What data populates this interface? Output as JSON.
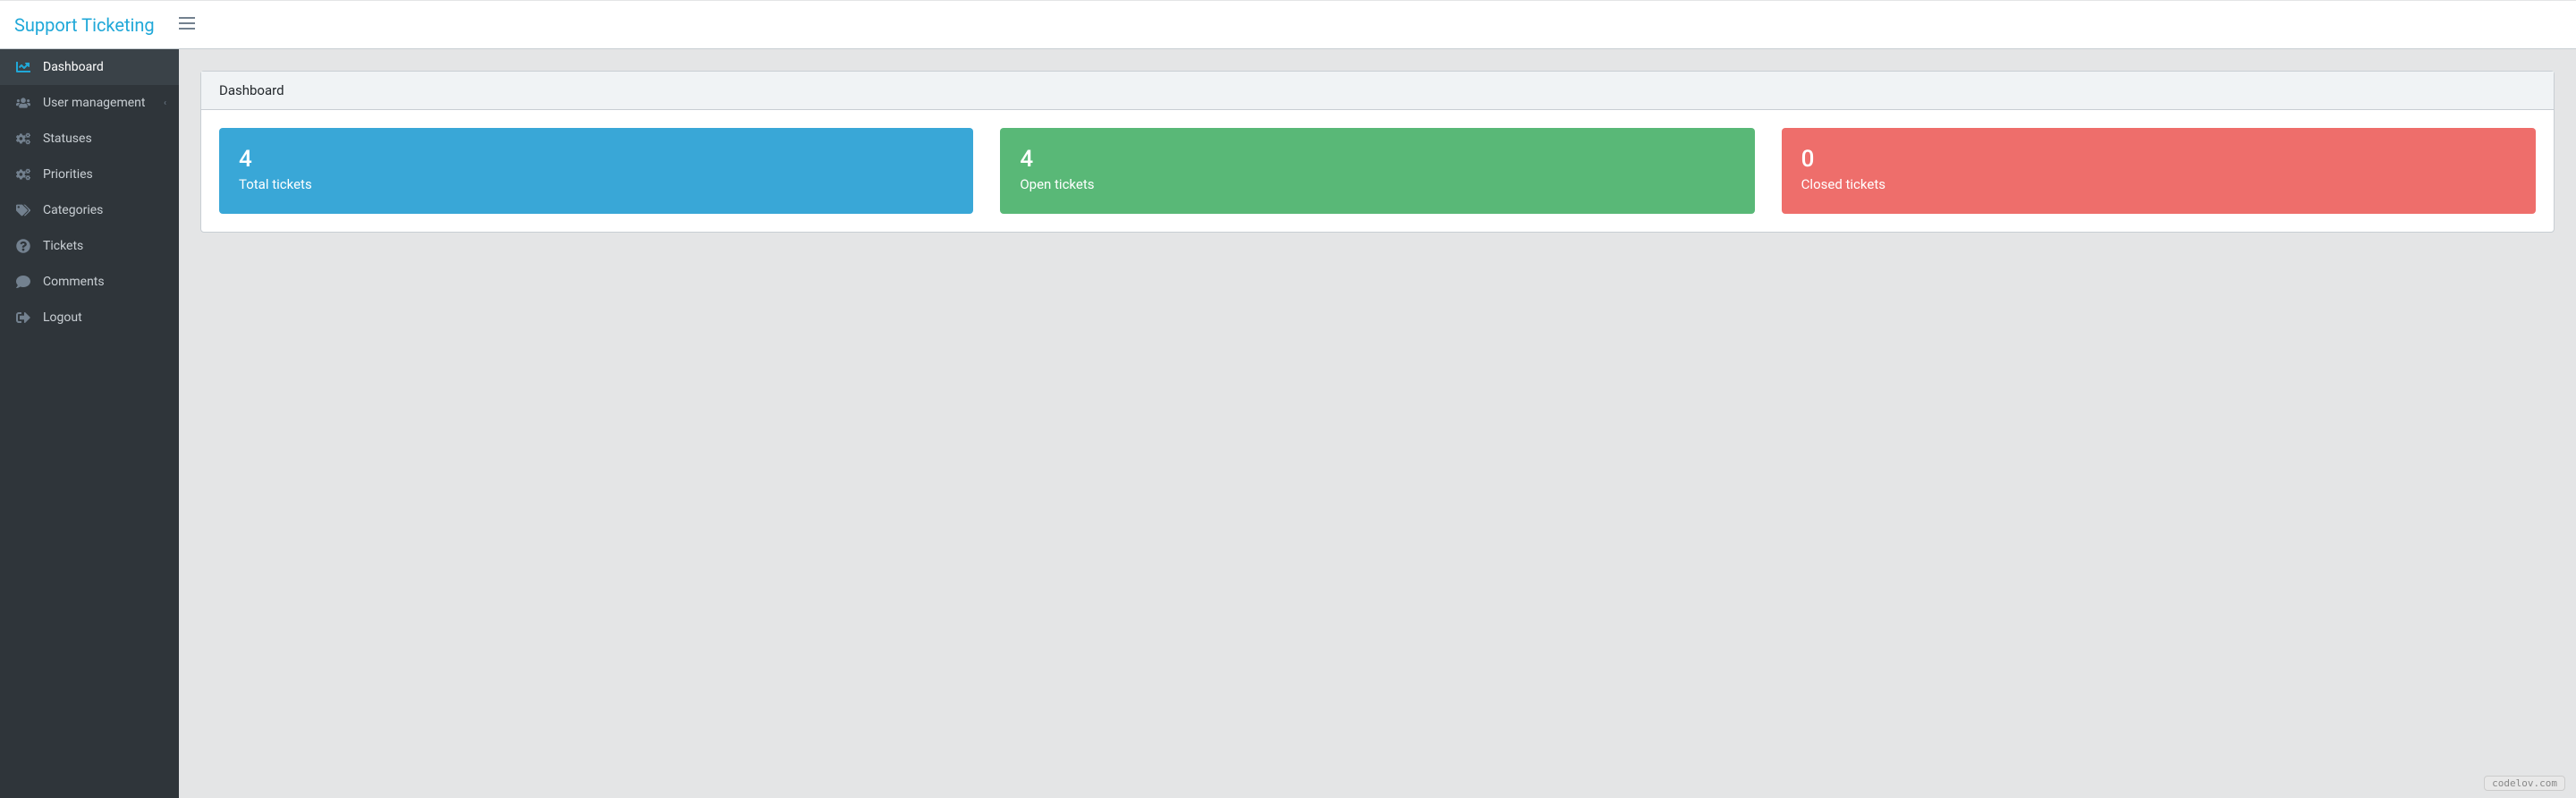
{
  "header": {
    "brand": "Support Ticketing"
  },
  "sidebar": {
    "items": [
      {
        "label": "Dashboard",
        "icon": "dashboard-icon",
        "active": true,
        "expandable": false
      },
      {
        "label": "User management",
        "icon": "users-icon",
        "active": false,
        "expandable": true
      },
      {
        "label": "Statuses",
        "icon": "cogs-icon",
        "active": false,
        "expandable": false
      },
      {
        "label": "Priorities",
        "icon": "cogs-icon",
        "active": false,
        "expandable": false
      },
      {
        "label": "Categories",
        "icon": "tags-icon",
        "active": false,
        "expandable": false
      },
      {
        "label": "Tickets",
        "icon": "question-icon",
        "active": false,
        "expandable": false
      },
      {
        "label": "Comments",
        "icon": "comment-icon",
        "active": false,
        "expandable": false
      },
      {
        "label": "Logout",
        "icon": "logout-icon",
        "active": false,
        "expandable": false
      }
    ]
  },
  "page": {
    "title": "Dashboard"
  },
  "stats": [
    {
      "value": "4",
      "label": "Total tickets",
      "color": "blue"
    },
    {
      "value": "4",
      "label": "Open tickets",
      "color": "green"
    },
    {
      "value": "0",
      "label": "Closed tickets",
      "color": "red"
    }
  ],
  "watermark": "codelov.com"
}
